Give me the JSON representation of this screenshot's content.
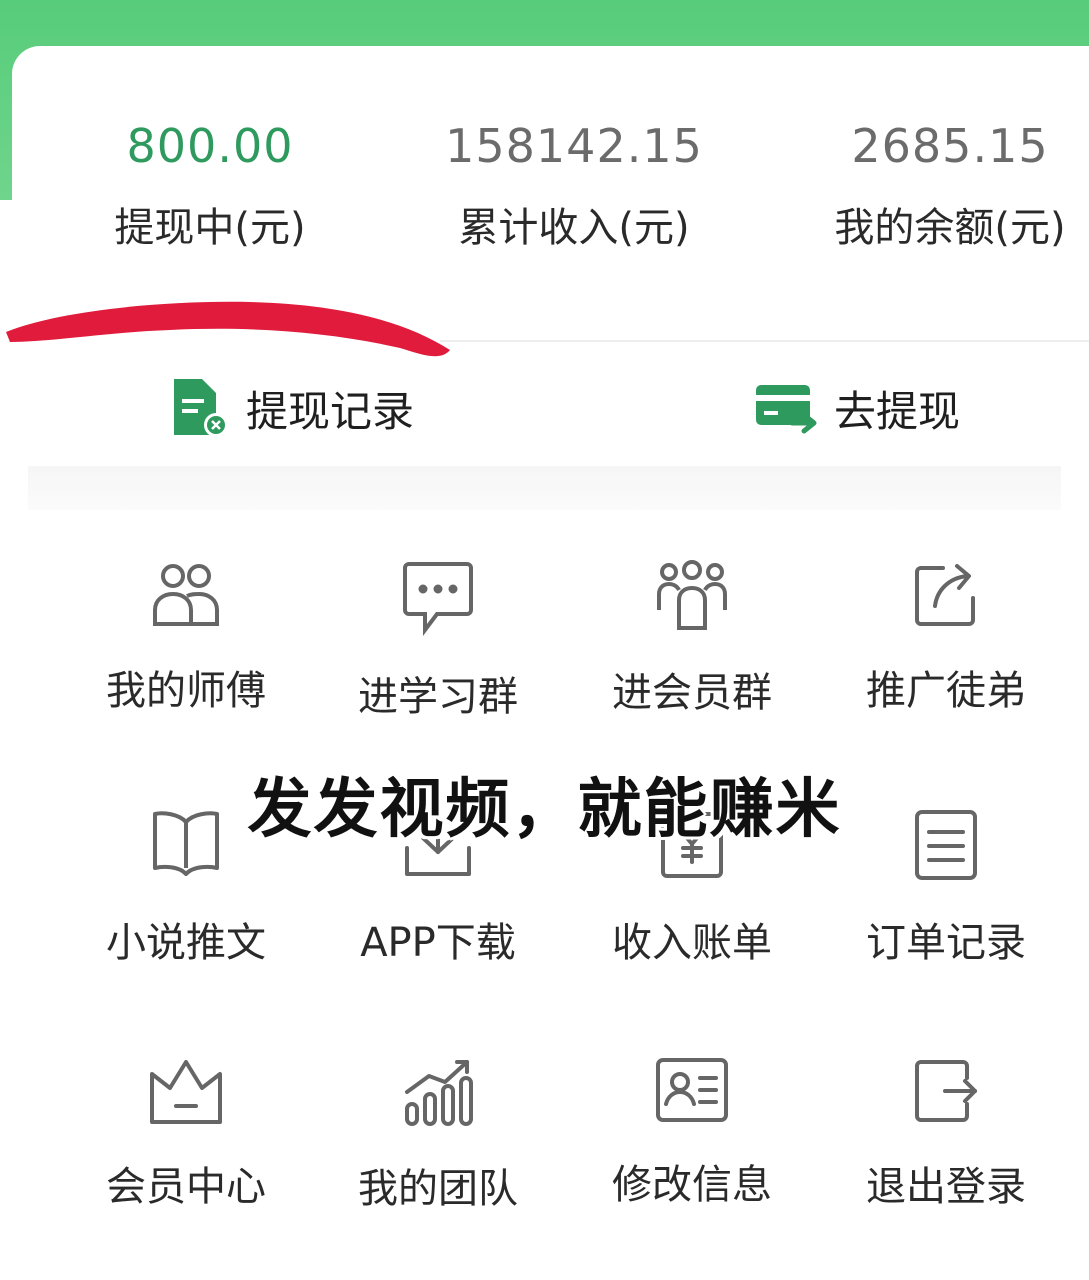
{
  "stats": [
    {
      "value": "800.00",
      "label": "提现中(元)"
    },
    {
      "value": "158142.15",
      "label": "累计收入(元)"
    },
    {
      "value": "2685.15",
      "label": "我的余额(元)"
    }
  ],
  "actions": {
    "withdraw_records": "提现记录",
    "withdraw": "去提现"
  },
  "menu": {
    "row1": [
      "我的师傅",
      "进学习群",
      "进会员群",
      "推广徒弟"
    ],
    "row2": [
      "小说推文",
      "APP下载",
      "收入账单",
      "订单记录"
    ],
    "row3": [
      "会员中心",
      "我的团队",
      "修改信息",
      "退出登录"
    ]
  },
  "overlay_caption": "发发视频，就能赚米",
  "colors": {
    "brand_green": "#57cc7a",
    "active_value": "#2f9a5e",
    "scribble_red": "#e01b3c"
  }
}
